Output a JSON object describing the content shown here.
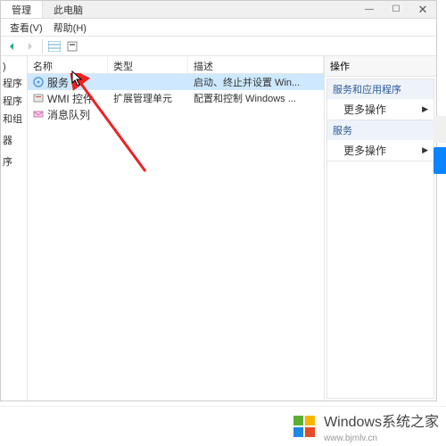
{
  "tabs": {
    "active": "管理",
    "other": "此电脑"
  },
  "winbtns": {
    "min": "—",
    "max": "☐",
    "close": "✕"
  },
  "menu": {
    "view": "查看(V)",
    "help": "帮助(H)"
  },
  "tree": {
    "root_suffix": ")",
    "items": [
      "程序",
      "程序",
      "和组",
      "",
      "器",
      "",
      "序"
    ]
  },
  "cols": {
    "name": "名称",
    "type": "类型",
    "desc": "描述"
  },
  "rows": [
    {
      "name": "服务",
      "type": "",
      "desc": "启动、终止并设置 Win...",
      "icon": "gear"
    },
    {
      "name": "WMI 控件",
      "type": "扩展管理单元",
      "desc": "配置和控制 Windows ...",
      "icon": "wmi"
    },
    {
      "name": "消息队列",
      "type": "",
      "desc": "",
      "icon": "msmq"
    }
  ],
  "actions": {
    "title": "操作",
    "sections": [
      {
        "header": "服务和应用程序",
        "items": [
          "更多操作"
        ]
      },
      {
        "header": "服务",
        "items": [
          "更多操作"
        ]
      }
    ]
  },
  "watermark": {
    "brand": "Windows",
    "sub": "系统之家",
    "url": "www.bjmlv.cn"
  }
}
